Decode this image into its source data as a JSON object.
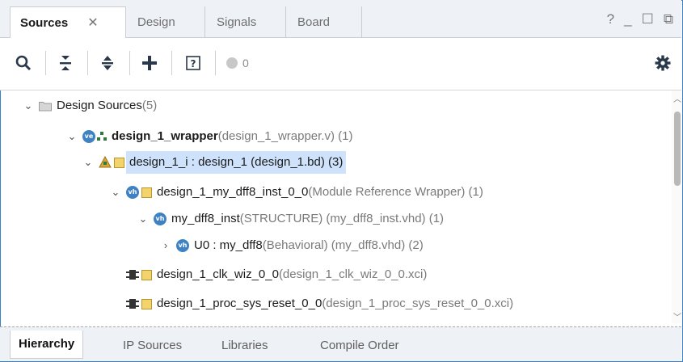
{
  "tabs": [
    {
      "label": "Sources",
      "active": true
    },
    {
      "label": "Design"
    },
    {
      "label": "Signals"
    },
    {
      "label": "Board"
    }
  ],
  "window": {
    "help": "?",
    "minimize": "_",
    "restore": "☐",
    "float": "⧉"
  },
  "toolbar": {
    "count": "0",
    "icons": [
      "search-icon",
      "collapse-all-icon",
      "expand-all-icon",
      "add-icon",
      "help-doc-icon",
      "status-dot-icon",
      "gear-icon"
    ]
  },
  "tree": [
    {
      "name": "Design Sources",
      "detail": " (5)"
    },
    {
      "name": "design_1_wrapper",
      "detail": " (design_1_wrapper.v) (1)"
    },
    {
      "name": "design_1_i : design_1 (design_1.bd) (3)",
      "detail": ""
    },
    {
      "name": "design_1_my_dff8_inst_0_0",
      "detail": " (Module Reference Wrapper) (1)"
    },
    {
      "name": "my_dff8_inst",
      "detail": "(STRUCTURE) (my_dff8_inst.vhd) (1)"
    },
    {
      "name": "U0 : my_dff8",
      "detail": "(Behavioral) (my_dff8.vhd) (2)"
    },
    {
      "name": "design_1_clk_wiz_0_0",
      "detail": " (design_1_clk_wiz_0_0.xci)"
    },
    {
      "name": "design_1_proc_sys_reset_0_0",
      "detail": " (design_1_proc_sys_reset_0_0.xci)"
    }
  ],
  "icon_labels": {
    "verilog": "ve",
    "vhdl": "vh"
  },
  "bottom_tabs": [
    {
      "label": "Hierarchy",
      "active": true
    },
    {
      "label": "IP Sources"
    },
    {
      "label": "Libraries"
    },
    {
      "label": "Compile Order"
    }
  ],
  "colors": {
    "accent": "#3c80c5",
    "selection": "#cfe2fb",
    "icon_blue": "#3f82c4",
    "ip_yellow": "#f3d36b"
  }
}
